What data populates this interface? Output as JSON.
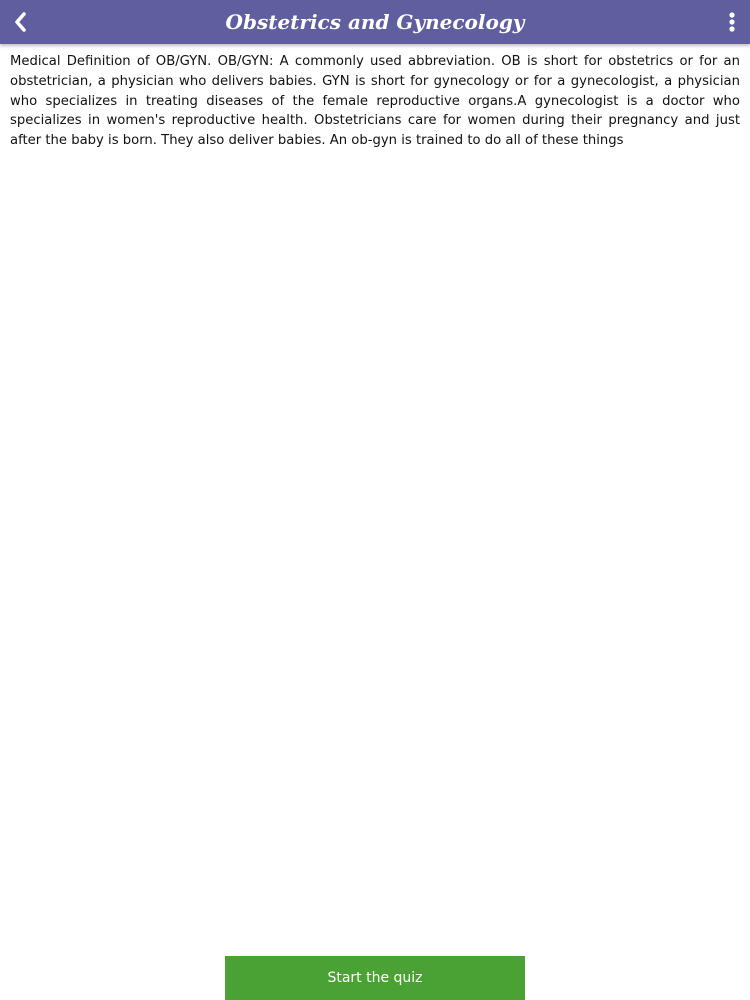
{
  "header": {
    "title": "Obstetrics and Gynecology",
    "back_icon": "chevron-left-icon",
    "menu_icon": "more-vertical-icon"
  },
  "content": {
    "body": "Medical Definition of OB/GYN. OB/GYN: A commonly used abbreviation. OB is short for obstetrics or for an obstetrician, a physician who delivers babies. GYN is short for gynecology or for a gynecologist, a physician who specializes in treating diseases of the female reproductive organs.A gynecologist is a doctor who specializes in women's reproductive health. Obstetricians care for women during their pregnancy and just after the baby is born. They also deliver babies. An ob-gyn is trained to do all of these things"
  },
  "footer": {
    "start_quiz_label": "Start the quiz"
  },
  "colors": {
    "header_bg": "#5f5e9f",
    "button_bg": "#4ba234",
    "text": "#111111"
  }
}
